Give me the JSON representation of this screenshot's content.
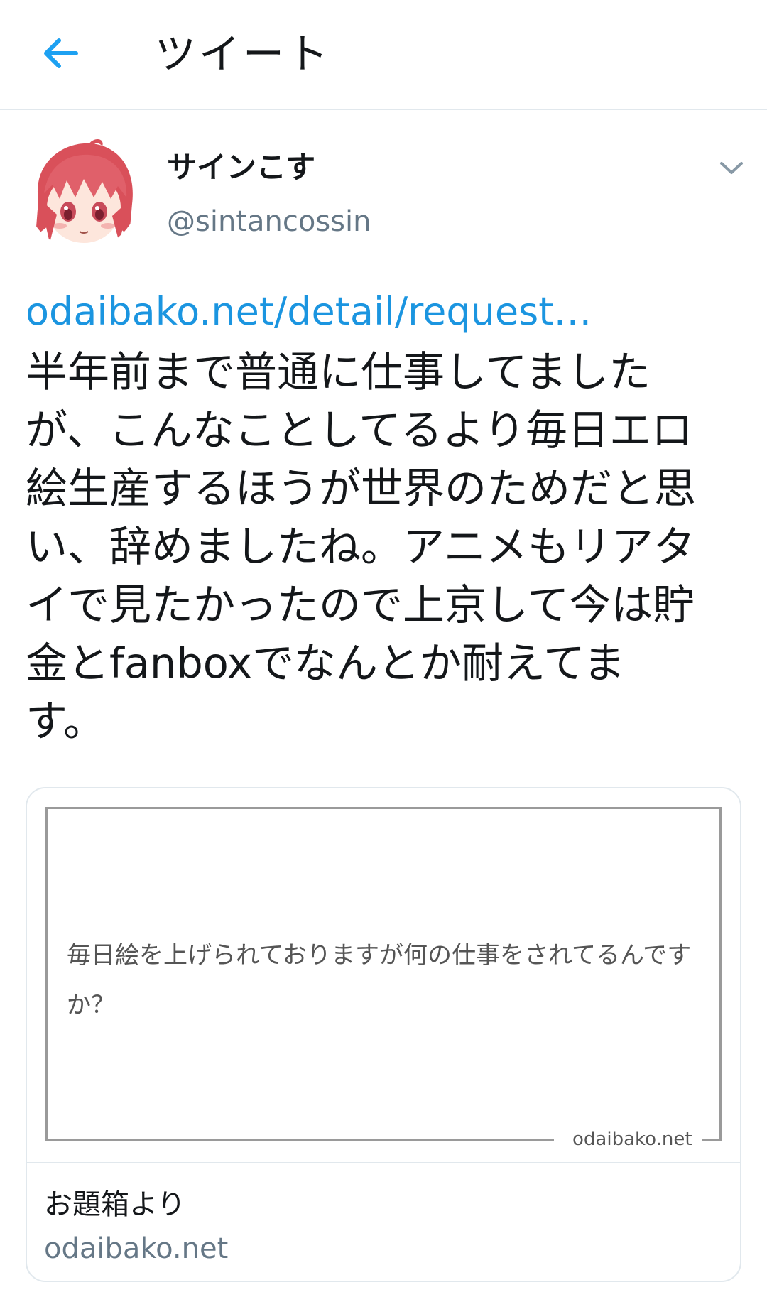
{
  "header": {
    "title": "ツイート",
    "back_icon": "arrow-left-icon",
    "accent_color": "#1da1f2"
  },
  "tweet": {
    "display_name": "サインこす",
    "handle": "@sintancossin",
    "link_text": "odaibako.net/detail/request…",
    "text_lines": [
      "半年前まで普通に仕事してました",
      "が、こんなことしてるより毎日エロ",
      "絵生産するほうが世界のためだと思",
      "い、辞めましたね。アニメもリアタ",
      "イで見たかったので上京して今は貯",
      "金とfanboxでなんとか耐えてま",
      "す。"
    ],
    "link_color": "#1b95e0",
    "menu_icon": "chevron-down-icon"
  },
  "card": {
    "image_question": "毎日絵を上げられておりますが何の仕事をされてるんですか？",
    "image_domain": "odaibako.net",
    "title": "お題箱より",
    "domain": "odaibako.net"
  }
}
